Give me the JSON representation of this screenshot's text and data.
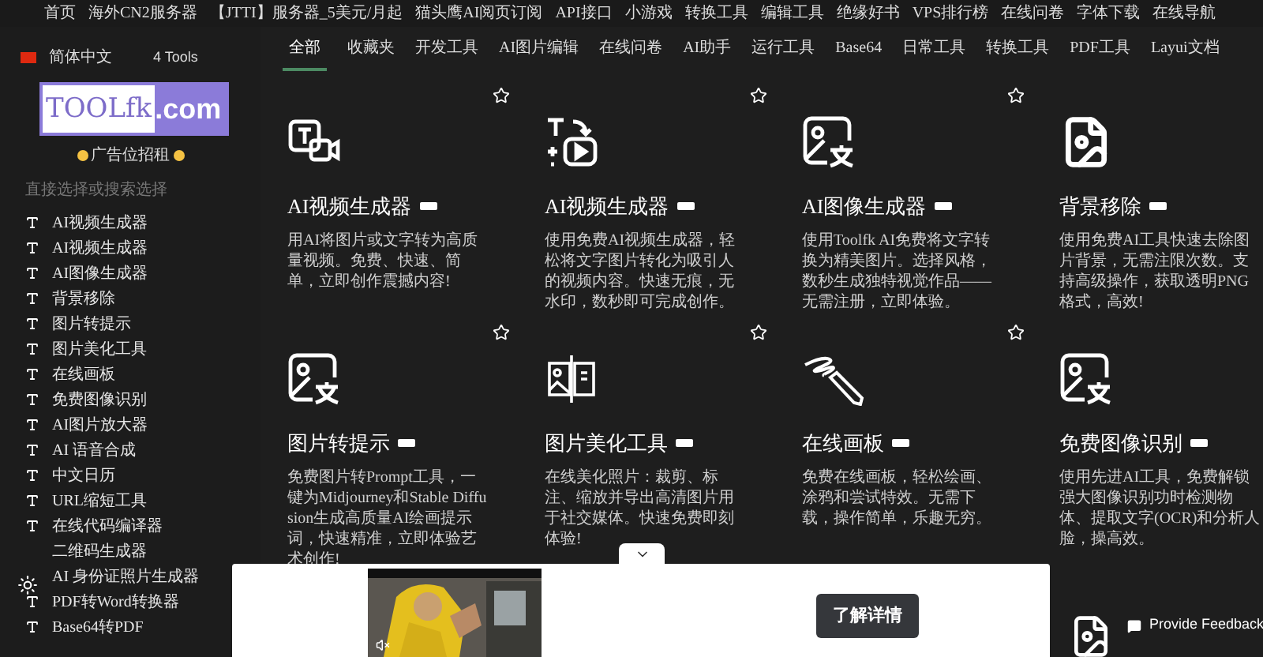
{
  "top_nav": [
    {
      "label": "首页"
    },
    {
      "label": "海外CN2服务器"
    },
    {
      "label": "【JTTI】服务器_5美元/月起"
    },
    {
      "label": "猫头鹰AI阅页订阅"
    },
    {
      "label": "API接口"
    },
    {
      "label": "小游戏"
    },
    {
      "label": "转换工具"
    },
    {
      "label": "编辑工具"
    },
    {
      "label": "绝缘好书"
    },
    {
      "label": "VPS排行榜"
    },
    {
      "label": "在线问卷"
    },
    {
      "label": "字体下载"
    },
    {
      "label": "在线导航"
    }
  ],
  "sidebar": {
    "language": "简体中文",
    "tool_count": "4 Tools",
    "logo": {
      "left": "TOOLfk",
      "right": ".com"
    },
    "ad_text": "广告位招租",
    "search": {
      "placeholder": "直接选择或搜索选择"
    },
    "items": [
      {
        "label": "AI视频生成器",
        "icon": true
      },
      {
        "label": "AI视频生成器",
        "icon": true
      },
      {
        "label": "AI图像生成器",
        "icon": true
      },
      {
        "label": "背景移除",
        "icon": true
      },
      {
        "label": "图片转提示",
        "icon": true
      },
      {
        "label": "图片美化工具",
        "icon": true
      },
      {
        "label": "在线画板",
        "icon": true
      },
      {
        "label": "免费图像识别",
        "icon": true
      },
      {
        "label": "AI图片放大器",
        "icon": true
      },
      {
        "label": "AI 语音合成",
        "icon": true
      },
      {
        "label": "中文日历",
        "icon": true
      },
      {
        "label": "URL缩短工具",
        "icon": true
      },
      {
        "label": "在线代码编译器",
        "icon": true
      },
      {
        "label": "二维码生成器",
        "icon": false
      },
      {
        "label": "AI 身份证照片生成器",
        "icon": false
      },
      {
        "label": "PDF转Word转换器",
        "icon": true
      },
      {
        "label": "Base64转PDF",
        "icon": true
      }
    ]
  },
  "tabs": [
    {
      "label": "全部",
      "selected": true
    },
    {
      "label": "收藏夹",
      "selected": false
    },
    {
      "label": "开发工具",
      "selected": false
    },
    {
      "label": "AI图片编辑",
      "selected": false
    },
    {
      "label": "在线问卷",
      "selected": false
    },
    {
      "label": "AI助手",
      "selected": false
    },
    {
      "label": "运行工具",
      "selected": false
    },
    {
      "label": "Base64",
      "selected": false
    },
    {
      "label": "日常工具",
      "selected": false
    },
    {
      "label": "转换工具",
      "selected": false
    },
    {
      "label": "PDF工具",
      "selected": false
    },
    {
      "label": "Layui文档",
      "selected": false
    }
  ],
  "cards": [
    {
      "kind": "text-video",
      "title": "AI视频生成器",
      "new": true,
      "starred": false,
      "description": "用AI将图片或文字转为高质量视频。免费、快速、简单，立即创作震撼内容!"
    },
    {
      "kind": "text-play",
      "title": "AI视频生成器",
      "new": true,
      "starred": false,
      "description": "使用免费AI视频生成器，轻松将文字图片转化为吸引人的视频内容。快速无痕，无水印，数秒即可完成创作。"
    },
    {
      "kind": "image-text",
      "title": "AI图像生成器",
      "new": true,
      "starred": false,
      "description": "使用Toolfk AI免费将文字转换为精美图片。选择风格，数秒生成独特视觉作品——无需注册，立即体验。"
    },
    {
      "kind": "file-image",
      "title": "背景移除",
      "new": true,
      "description": "使用免费AI工具快速去除图片背景，无需注限次数。支持高级操作，获取透明PNG格式，高效!"
    },
    {
      "kind": "image-text",
      "title": "图片转提示",
      "new": true,
      "starred": false,
      "description": "免费图片转Prompt工具，一键为Midjourney和Stable Diffusion生成高质量AI绘画提示词，快速精准，立即体验艺术创作!"
    },
    {
      "kind": "split-image",
      "title": "图片美化工具",
      "new": true,
      "starred": false,
      "description": "在线美化照片：裁剪、标注、缩放并导出高清图片用于社交媒体。快速免费即刻体验!"
    },
    {
      "kind": "pencil",
      "title": "在线画板",
      "new": true,
      "starred": false,
      "description": "免费在线画板，轻松绘画、涂鸦和尝试特效。无需下载，操作简单，乐趣无穷。"
    },
    {
      "kind": "image-text",
      "title": "免费图像识别",
      "new": true,
      "description": "使用先进AI工具，免费解锁强大图像识别功时检测物体、提取文字(OCR)和分析人脸，操高效。"
    }
  ],
  "ad": {
    "kind": "picture",
    "button": "了解详情"
  },
  "feedback": {
    "label": "Provide Feedback"
  }
}
